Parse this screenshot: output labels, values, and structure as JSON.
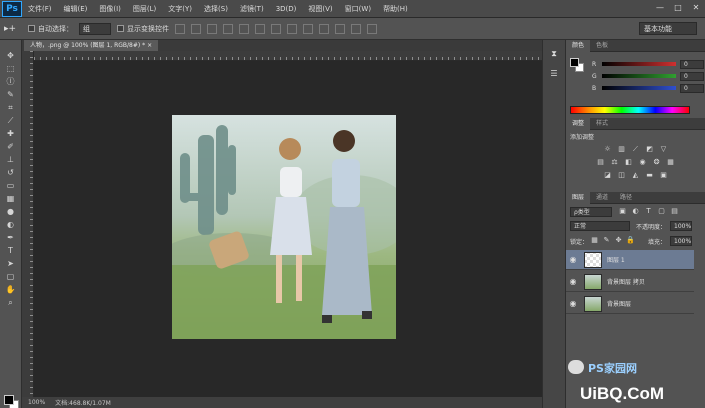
{
  "app": {
    "logo": "Ps"
  },
  "menu": [
    "文件(F)",
    "编辑(E)",
    "图像(I)",
    "图层(L)",
    "文字(Y)",
    "选择(S)",
    "滤镜(T)",
    "3D(D)",
    "视图(V)",
    "窗口(W)",
    "帮助(H)"
  ],
  "window_controls": [
    "—",
    "□",
    "✕"
  ],
  "options": {
    "auto_select_label": "自动选择：",
    "auto_select_value": "组",
    "show_transform_label": "显示变换控件",
    "workspace": "基本功能"
  },
  "document": {
    "tab_title": "人物，.png @ 100% (图层 1, RGB/8#) *",
    "close": "×"
  },
  "status": {
    "zoom": "100%",
    "doc_info": "文档:468.8K/1.07M"
  },
  "color_panel": {
    "tabs": [
      "颜色",
      "色板"
    ],
    "channels": [
      {
        "label": "R",
        "value": "0",
        "color": "#d03030"
      },
      {
        "label": "G",
        "value": "0",
        "color": "#30a030"
      },
      {
        "label": "B",
        "value": "0",
        "color": "#3050d0"
      }
    ]
  },
  "adjust_panel": {
    "tabs": [
      "调整",
      "样式"
    ],
    "title": "添加调整"
  },
  "layers_panel": {
    "tabs": [
      "图层",
      "通道",
      "路径"
    ],
    "kind_label": "ρ类型",
    "blend_mode": "正常",
    "opacity_label": "不透明度：",
    "opacity_value": "100%",
    "lock_label": "锁定：",
    "fill_label": "填充：",
    "fill_value": "100%",
    "layers": [
      {
        "name": "图层 1",
        "selected": true
      },
      {
        "name": "背景图层 拷贝",
        "selected": false
      },
      {
        "name": "背景图层",
        "selected": false
      }
    ]
  },
  "watermark": {
    "line1": "PS家园网",
    "line2": "UiBQ.CoM"
  },
  "icons": {
    "toolbar": [
      "move-icon",
      "marquee-icon",
      "lasso-icon",
      "quick-select-icon",
      "crop-icon",
      "eyedropper-icon",
      "healing-icon",
      "brush-icon",
      "stamp-icon",
      "history-brush-icon",
      "eraser-icon",
      "gradient-icon",
      "blur-icon",
      "dodge-icon",
      "pen-icon",
      "type-icon",
      "path-select-icon",
      "shape-icon",
      "hand-icon",
      "zoom-icon"
    ]
  }
}
